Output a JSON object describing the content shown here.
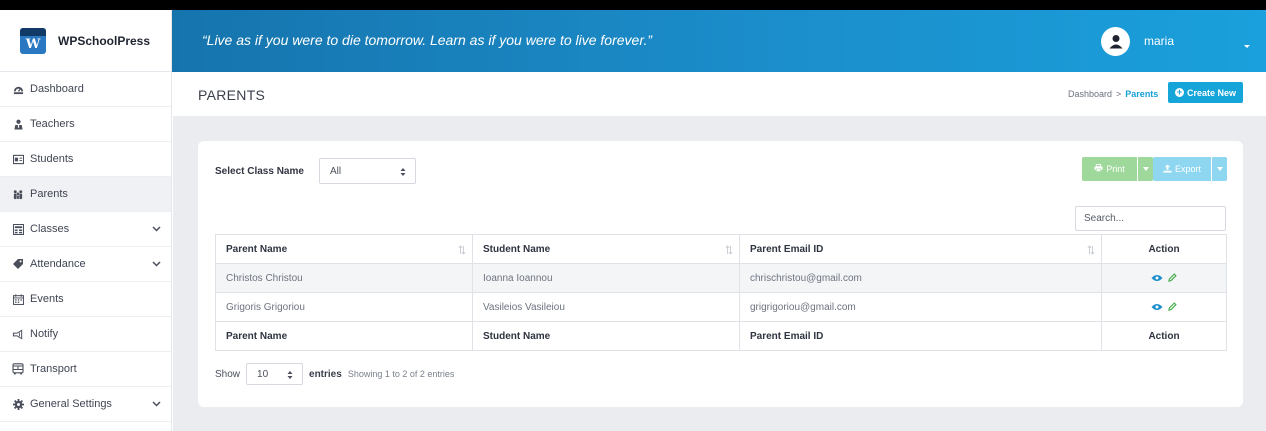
{
  "app": {
    "name": "WPSchoolPress",
    "quote": "“Live as if you were to die tomorrow. Learn as if you were to live forever.”",
    "user": "maria"
  },
  "sidebar": {
    "items": [
      {
        "label": "Dashboard",
        "icon": "dashboard-icon",
        "chevron": false
      },
      {
        "label": "Teachers",
        "icon": "teacher-icon",
        "chevron": false
      },
      {
        "label": "Students",
        "icon": "students-icon",
        "chevron": false
      },
      {
        "label": "Parents",
        "icon": "parents-icon",
        "chevron": false,
        "active": true
      },
      {
        "label": "Classes",
        "icon": "classes-icon",
        "chevron": true
      },
      {
        "label": "Attendance",
        "icon": "attendance-icon",
        "chevron": true
      },
      {
        "label": "Events",
        "icon": "calendar-icon",
        "chevron": false
      },
      {
        "label": "Notify",
        "icon": "notify-icon",
        "chevron": false
      },
      {
        "label": "Transport",
        "icon": "bus-icon",
        "chevron": false
      },
      {
        "label": "General Settings",
        "icon": "gear-icon",
        "chevron": true
      }
    ]
  },
  "page": {
    "title": "PARENTS",
    "breadcrumb": {
      "home": "Dashboard",
      "sep": ">",
      "current": "Parents"
    },
    "create_label": "Create New"
  },
  "filter": {
    "label": "Select Class Name",
    "value": "All"
  },
  "toolbar": {
    "print_label": "Print",
    "export_label": "Export"
  },
  "search": {
    "placeholder": "Search..."
  },
  "table": {
    "headers": [
      "Parent Name",
      "Student Name",
      "Parent Email ID",
      "Action"
    ],
    "rows": [
      [
        "Christos Christou",
        "Ioanna Ioannou",
        "chrischristou@gmail.com"
      ],
      [
        "Grigoris Grigoriou",
        "Vasileios Vasileiou",
        "grigrigoriou@gmail.com"
      ]
    ]
  },
  "pagination": {
    "show_label": "Show",
    "length_value": "10",
    "entries_label": "entries",
    "info": "Showing 1 to 2 of 2 entries"
  },
  "colors": {
    "header_from": "#1674ad",
    "header_to": "#1aa0dc",
    "accent": "#15a5d9",
    "print_button": "#9fd89b",
    "export_button": "#8fd7f0"
  }
}
